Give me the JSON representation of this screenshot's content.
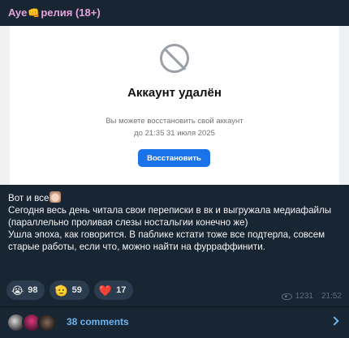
{
  "channel": {
    "name_prefix": "Aye",
    "name_emoji": "👊",
    "name_suffix": "релия (18+)"
  },
  "screenshot": {
    "title": "Аккаунт удалён",
    "restore_line1": "Вы можете восстановить свой аккаунт",
    "restore_line2": "до 21:35 31 июля 2025",
    "restore_button": "Восстановить"
  },
  "message": {
    "line_first": "Вот и все",
    "paragraph1": "Сегодня весь день читала свои переписки в вк и выгружала медиафайлы (параллельно проливая слезы ностальгии конечно же)",
    "paragraph2": "Ушла эпоха, как говорится. В паблике кстати тоже все подтерла, совсем старые работы, если что, можно найти на фурраффинити."
  },
  "reactions": [
    {
      "icon": "😭",
      "icon_name": "crying-face-icon",
      "count": "98"
    },
    {
      "icon": "🫡",
      "icon_name": "saluting-face-icon",
      "count": "59"
    },
    {
      "icon": "❤️",
      "icon_name": "red-heart-icon",
      "count": "17"
    }
  ],
  "meta": {
    "views": "1231",
    "time": "21:52"
  },
  "comments": {
    "label": "38 comments"
  },
  "colors": {
    "background": "#182533",
    "channel_name": "#e8a3d9",
    "link": "#6bb4f0",
    "reaction_bg": "#2b3c4f",
    "restore_button": "#1a73e8"
  }
}
